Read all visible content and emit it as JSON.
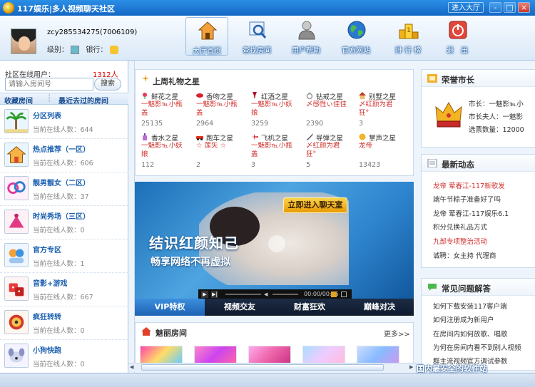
{
  "window": {
    "title": "117娱乐|多人视频聊天社区",
    "enter_hall": "进入大厅",
    "btn_min": "-",
    "btn_max": "□",
    "btn_close": "×"
  },
  "user": {
    "name": "zcy285534275(7006109)",
    "level_label": "级别：",
    "bank_label": "银行："
  },
  "nav": [
    {
      "label": "大厅首页"
    },
    {
      "label": "查找房间"
    },
    {
      "label": "用户帮助"
    },
    {
      "label": "官方网站"
    },
    {
      "label": "排 行 榜"
    },
    {
      "label": "退　出"
    }
  ],
  "left": {
    "online_label": "社区在线用户：",
    "online_count": "1312人",
    "search_placeholder": "请输入房间号",
    "search_button": "搜索",
    "tab_fav": "收藏房间",
    "tab_sep": "┆",
    "tab_recent": "最近去过的房间",
    "rooms": [
      {
        "name": "分区列表",
        "count": "当前在线人数：644"
      },
      {
        "name": "热点推荐（一区）",
        "count": "当前在线人数：606"
      },
      {
        "name": "靓男靓女（二区）",
        "count": "当前在线人数：37"
      },
      {
        "name": "时尚秀场（三区）",
        "count": "当前在线人数：0"
      },
      {
        "name": "官方专区",
        "count": "当前在线人数：1"
      },
      {
        "name": "音影+游戏",
        "count": "当前在线人数：667"
      },
      {
        "name": "疯狂转转",
        "count": "当前在线人数：0"
      },
      {
        "name": "小狗快跑",
        "count": "当前在线人数：0"
      }
    ]
  },
  "gifts": {
    "title": "上周礼物之星",
    "items": [
      {
        "name": "鲜花之星",
        "user": "一魅影℡小瓶盖",
        "value": "25135"
      },
      {
        "name": "香吻之星",
        "user": "一魅影℡小瓶盖",
        "value": "2964"
      },
      {
        "name": "红酒之星",
        "user": "一魅影℡小妖娘",
        "value": "3259"
      },
      {
        "name": "钻戒之星",
        "user": "〆感性ぃ佳佳",
        "value": "2390"
      },
      {
        "name": "别墅之星",
        "user": "〆红颜为君狂°",
        "value": "3"
      },
      {
        "name": "香水之星",
        "user": "一魅影℡小妖娘",
        "value": "112"
      },
      {
        "name": "跑车之星",
        "user": "☆ 莲矢 ☆",
        "value": "2"
      },
      {
        "name": "飞机之星",
        "user": "一魅影℡小瓶盖",
        "value": "3"
      },
      {
        "name": "导弹之星",
        "user": "〆红颜为君狂°",
        "value": "5"
      },
      {
        "name": "掌声之星",
        "user": "龙帝",
        "value": "13423"
      }
    ]
  },
  "banner": {
    "enter_button": "立即进入聊天室",
    "headline": "结识红颜知己",
    "subline": "畅享网络不再虚拟",
    "time": "00:00/00:15"
  },
  "banner_tabs": [
    "VIP特权",
    "视频交友",
    "财富狂欢",
    "巅峰对决"
  ],
  "charm": {
    "title": "魅丽房间",
    "more": "更多>>"
  },
  "honor": {
    "title": "荣誉市长",
    "mayor": "市长：一魅影℡小",
    "lady": "市长夫人：一魅影",
    "votes": "选票数量：12000"
  },
  "news": {
    "title": "最新动态",
    "items": [
      {
        "text": "龙帝 荤春江-117新歌发",
        "color": "#d0312d"
      },
      {
        "text": "端午节粽子准备好了吗",
        "color": "#333333"
      },
      {
        "text": "龙帝 荤春江-117娱乐6.1",
        "color": "#333333"
      },
      {
        "text": "积分兑换礼品方式",
        "color": "#333333"
      },
      {
        "text": "九部专项整治活动",
        "color": "#d0312d"
      },
      {
        "text": "诚聘：女主持 代理商",
        "color": "#333333"
      }
    ]
  },
  "faq": {
    "title": "常见问题解答",
    "items": [
      "如何下载安装117客户端",
      "如何注册成为新用户",
      "在房间内如何放歌、唱歌",
      "为何在房间内看不到别人视频",
      "群主流视频官方调试参数"
    ]
  },
  "watermark": "国内最安全的软件站"
}
